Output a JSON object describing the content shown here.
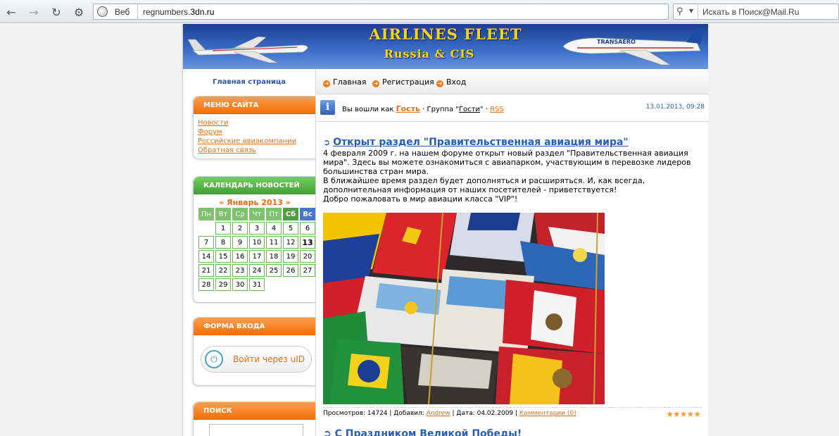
{
  "browser": {
    "mode_label": "Веб",
    "url_domain": "regnumbers.",
    "url_host": "3dn.ru",
    "search_placeholder": "Искать в Поиск@Mail.Ru"
  },
  "banner": {
    "title": "AIRLINES FLEET",
    "subtitle": "Russia  &  CIS"
  },
  "sidebar": {
    "home_link": "Главная страница",
    "menu": {
      "title": "МЕНЮ САЙТА",
      "items": [
        "Новости",
        "Форум",
        "Российские авиакомпании",
        "Обратная связь"
      ]
    },
    "calendar": {
      "title": "КАЛЕНДАРЬ НОВОСТЕЙ",
      "month_label": "«  Январь 2013  »",
      "weekdays": [
        "Пн",
        "Вт",
        "Ср",
        "Чт",
        "Пт",
        "Сб",
        "Вс"
      ],
      "today": "13"
    },
    "login": {
      "title": "ФОРМА ВХОДА",
      "uid_button": "Войти через uID"
    },
    "search": {
      "title": "ПОИСК"
    }
  },
  "topnav": {
    "items": [
      "Главная",
      "Регистрация",
      "Вход"
    ]
  },
  "loginbar": {
    "prefix": "Вы вошли как ",
    "user": "Гость",
    "group_prefix": " · Группа \"",
    "group": "Гости",
    "group_suffix": "\" · ",
    "rss": "RSS",
    "datetime": "13.01.2013, 09:28"
  },
  "post": {
    "title": "Открыт раздел \"Правительственная авиация мира\"",
    "paragraphs": [
      "4 февраля 2009 г. на нашем форуме открыт новый раздел \"Правительственная авиация мира\". Здесь вы можете ознакомиться с авиапарком, участвующим в перевозке лидеров большинства стран мира.",
      "В ближайшее время раздел будет дополняться и расширяться. И, как всегда, дополнительная информация от наших посетителей - приветствуется!",
      "Добро пожаловать в мир авиации класса \"VIP\"!"
    ],
    "meta": {
      "views_label": "Просмотров: 14724 | Добавил: ",
      "author": "Andrew",
      "date_label": " | Дата: 04.02.2009 | ",
      "comments": "Комментарии (0)"
    },
    "rating_stars": "★★★★★"
  },
  "next_post": {
    "title": "С Праздником Великой Победы!"
  }
}
